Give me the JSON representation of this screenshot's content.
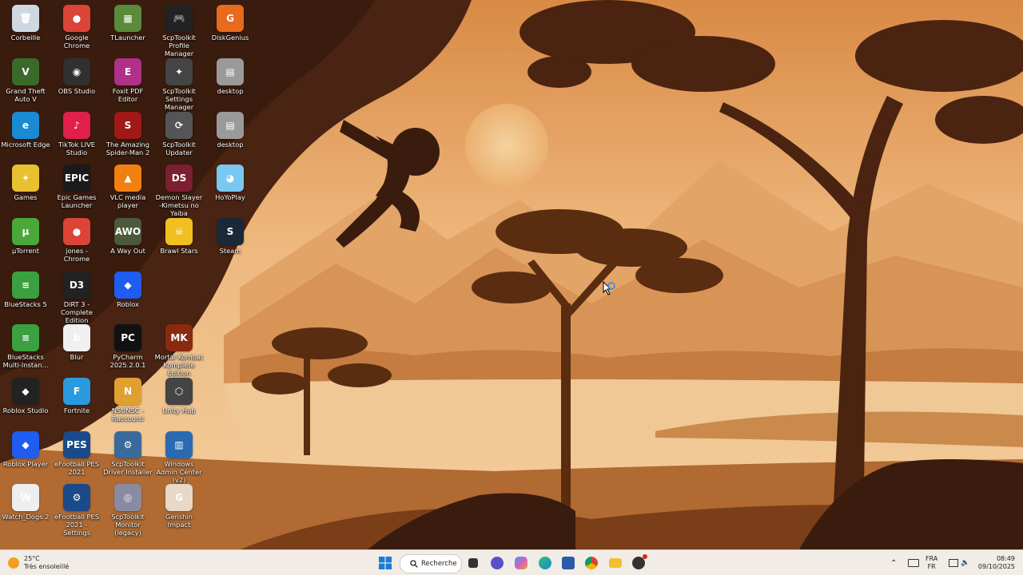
{
  "desktop": {
    "icons": [
      {
        "label": "Corbeille",
        "glyph": "🗑",
        "color": "#cfd8e0"
      },
      {
        "label": "Google Chrome",
        "glyph": "●",
        "color": "#db4437"
      },
      {
        "label": "TLauncher",
        "glyph": "▦",
        "color": "#5a8a3a"
      },
      {
        "label": "ScpToolkit Profile Manager",
        "glyph": "🎮",
        "color": "#222222"
      },
      {
        "label": "DiskGenius",
        "glyph": "G",
        "color": "#e86a1c"
      },
      {
        "label": "Grand Theft Auto V",
        "glyph": "V",
        "color": "#3a6a2a"
      },
      {
        "label": "OBS Studio",
        "glyph": "◉",
        "color": "#303030"
      },
      {
        "label": "Foxit PDF Editor",
        "glyph": "E",
        "color": "#b0308a"
      },
      {
        "label": "ScpToolkit Settings Manager",
        "glyph": "✦",
        "color": "#444444"
      },
      {
        "label": "desktop",
        "glyph": "▤",
        "color": "#9a9a9a"
      },
      {
        "label": "Microsoft Edge",
        "glyph": "e",
        "color": "#1a8ad4"
      },
      {
        "label": "TikTok LIVE Studio",
        "glyph": "♪",
        "color": "#e0204a"
      },
      {
        "label": "The Amazing Spider-Man 2",
        "glyph": "S",
        "color": "#a01818"
      },
      {
        "label": "ScpToolkit Updater",
        "glyph": "⟳",
        "color": "#555555"
      },
      {
        "label": "desktop",
        "glyph": "▤",
        "color": "#9a9a9a"
      },
      {
        "label": "Games",
        "glyph": "✦",
        "color": "#e8c030"
      },
      {
        "label": "Epic Games Launcher",
        "glyph": "EPIC",
        "color": "#1a1a1a"
      },
      {
        "label": "VLC media player",
        "glyph": "▲",
        "color": "#f08010"
      },
      {
        "label": "Demon Slayer -Kimetsu no Yaiba",
        "glyph": "DS",
        "color": "#7a2030"
      },
      {
        "label": "HoYoPlay",
        "glyph": "◕",
        "color": "#78c8f0"
      },
      {
        "label": "µTorrent",
        "glyph": "µ",
        "color": "#4aa83a"
      },
      {
        "label": "jones - Chrome",
        "glyph": "●",
        "color": "#db4437"
      },
      {
        "label": "A Way Out",
        "glyph": "AWO",
        "color": "#4a5a3a"
      },
      {
        "label": "Brawl Stars",
        "glyph": "☠",
        "color": "#f0c020"
      },
      {
        "label": "Steam",
        "glyph": "S",
        "color": "#1b2838"
      },
      {
        "label": "BlueStacks 5",
        "glyph": "≡",
        "color": "#3aa040"
      },
      {
        "label": "DiRT 3 -Complete Edition",
        "glyph": "D3",
        "color": "#222222"
      },
      {
        "label": "Roblox",
        "glyph": "◆",
        "color": "#1f5cf0"
      },
      {
        "label": "BlueStacks Multi-Instan...",
        "glyph": "≡",
        "color": "#3aa040"
      },
      {
        "label": "Blur",
        "glyph": "b",
        "color": "#f0f0f0"
      },
      {
        "label": "PyCharm 2025.2.0.1",
        "glyph": "PC",
        "color": "#111111"
      },
      {
        "label": "Mortal Kombat Komplete Edition",
        "glyph": "MK",
        "color": "#8a2a10"
      },
      {
        "label": "Roblox Studio",
        "glyph": "◆",
        "color": "#222222"
      },
      {
        "label": "Fortnite",
        "glyph": "F",
        "color": "#2a9ae0"
      },
      {
        "label": "NSUNSC -Raccourci",
        "glyph": "N",
        "color": "#e0a030"
      },
      {
        "label": "Unity Hub",
        "glyph": "⬡",
        "color": "#444444"
      },
      {
        "label": "Roblox Player",
        "glyph": "◆",
        "color": "#1f5cf0"
      },
      {
        "label": "eFootball PES 2021",
        "glyph": "PES",
        "color": "#1a4a8a"
      },
      {
        "label": "ScpToolkit Driver Installer",
        "glyph": "⚙",
        "color": "#3a6a9a"
      },
      {
        "label": "Windows Admin Center (v2)",
        "glyph": "▥",
        "color": "#2a6ab0"
      },
      {
        "label": "Watch_Dogs 2",
        "glyph": "W",
        "color": "#eeeeee"
      },
      {
        "label": "eFootball PES 2021 - Settings",
        "glyph": "⚙",
        "color": "#1a4a8a"
      },
      {
        "label": "ScpToolkit Monitor (legacy)",
        "glyph": "◎",
        "color": "#8a8aa0"
      },
      {
        "label": "Genshin Impact",
        "glyph": "G",
        "color": "#e8d8c8"
      }
    ]
  },
  "taskbar": {
    "weather": {
      "temp": "25°C",
      "desc": "Très ensoleillé"
    },
    "search_label": "Recherche",
    "apps": [
      {
        "name": "start-button",
        "color": "#1a7ad8"
      },
      {
        "name": "task-view-button",
        "color": "#333333"
      },
      {
        "name": "chat-app",
        "color": "#5a50c8"
      },
      {
        "name": "copilot-app",
        "color": "#d060c0"
      },
      {
        "name": "edge-app",
        "color": "#1a8ad4"
      },
      {
        "name": "store-app",
        "color": "#2a5aa8"
      },
      {
        "name": "chrome-app",
        "color": "#db4437"
      },
      {
        "name": "file-explorer-app",
        "color": "#f0c030"
      },
      {
        "name": "recorder-app",
        "color": "#333333"
      }
    ],
    "tray": {
      "lang_top": "FRA",
      "lang_bottom": "FR",
      "time": "08:49",
      "date": "09/10/2025"
    }
  }
}
